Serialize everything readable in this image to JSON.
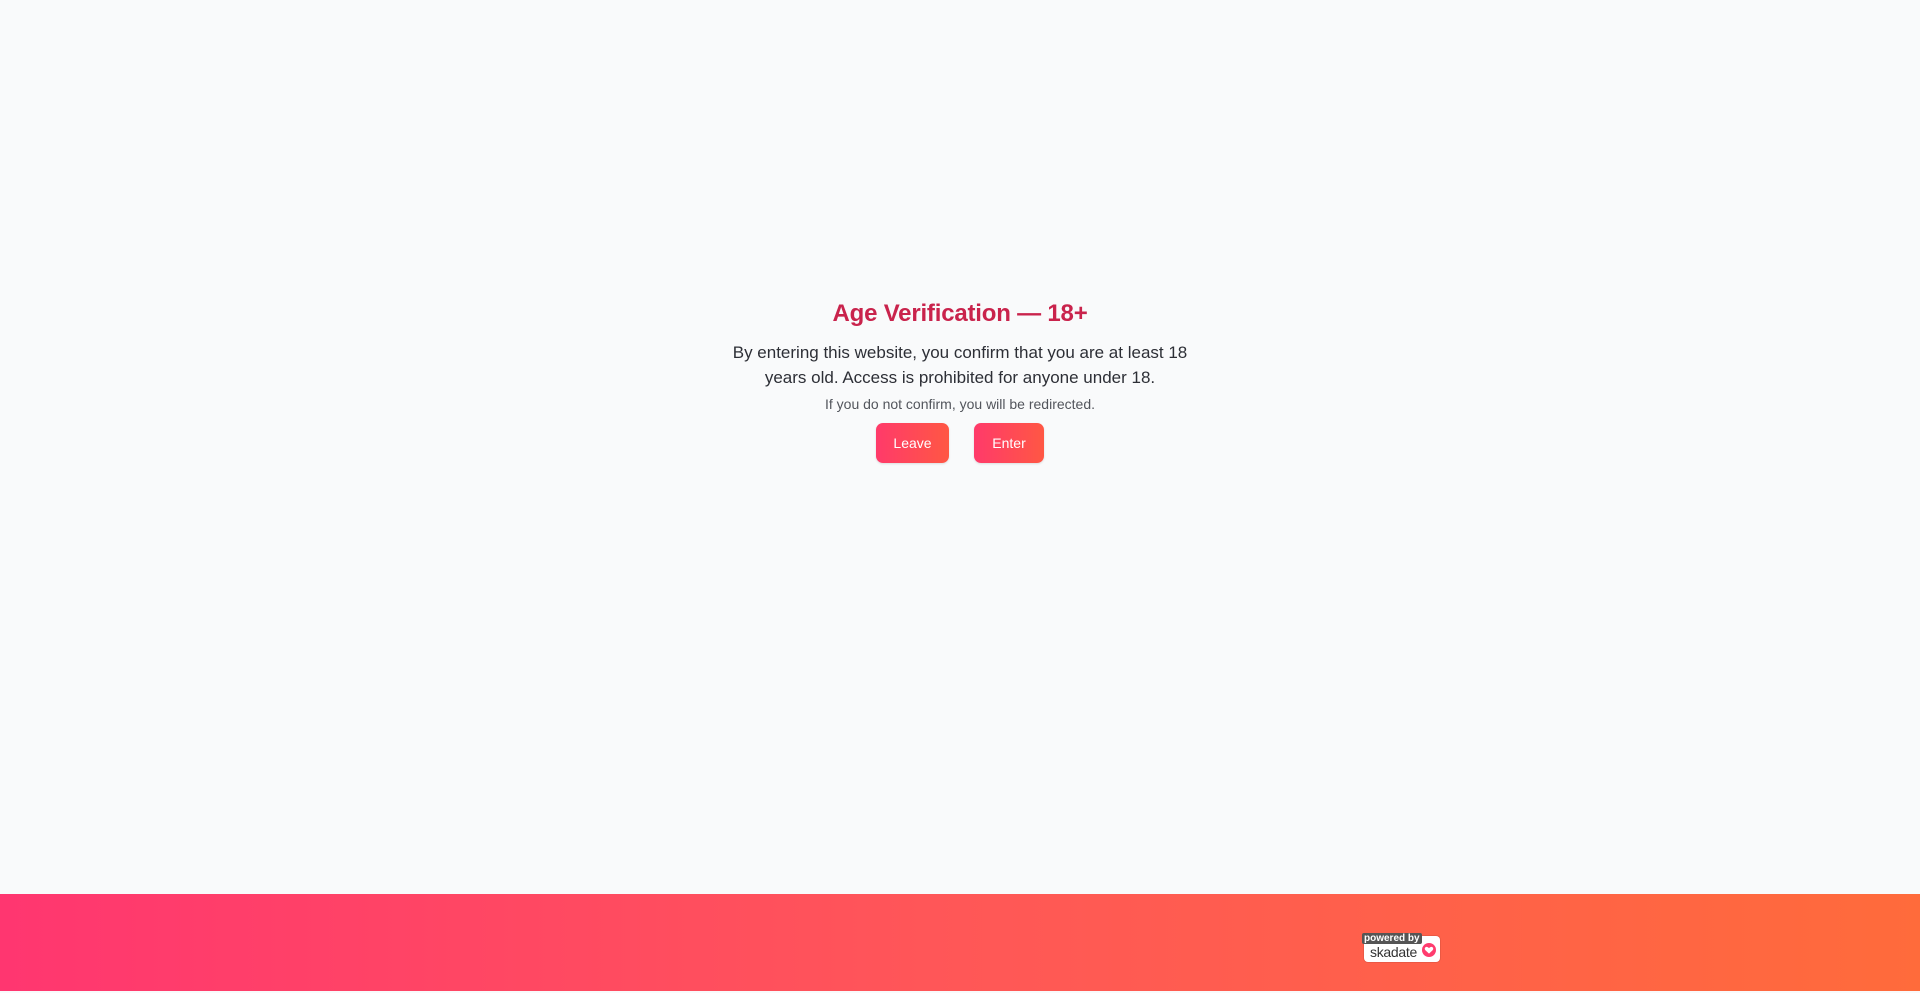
{
  "age_gate": {
    "title": "Age Verification — 18+",
    "message": "By entering this website, you confirm that you are at least 18 years old. Access is prohibited for anyone under 18.",
    "note": "If you do not confirm, you will be redirected.",
    "leave_label": "Leave",
    "enter_label": "Enter"
  },
  "footer": {
    "powered_by": "powered by",
    "brand": "skadate",
    "icon": "heart-icon"
  },
  "colors": {
    "title": "#c9234c",
    "button_start": "#ff3a6a",
    "button_end": "#ff5744",
    "footer_start": "#ff3670",
    "footer_end": "#ff6b3b",
    "background": "#f9fafb"
  }
}
